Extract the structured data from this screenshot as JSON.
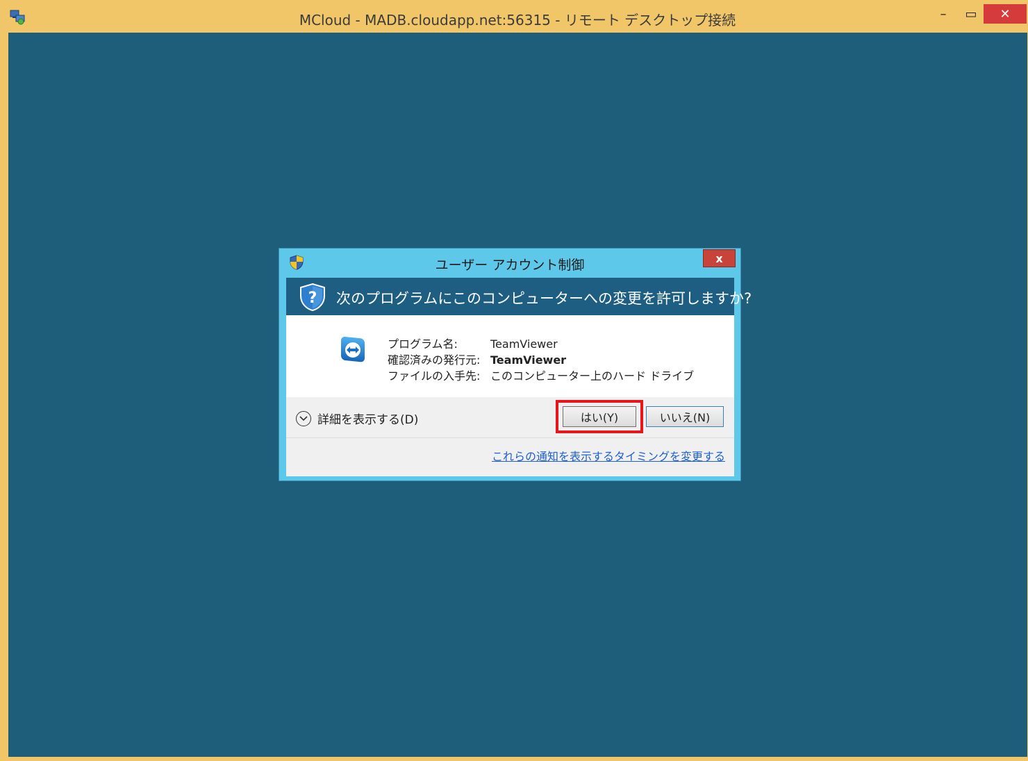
{
  "window": {
    "title": "MCloud - MADB.cloudapp.net:56315 - リモート デスクトップ接続",
    "minimize_label": "–",
    "maximize_label": "▭",
    "close_label": "✕"
  },
  "uac": {
    "title": "ユーザー アカウント制御",
    "close_label": "x",
    "question": "次のプログラムにこのコンピューターへの変更を許可しますか?",
    "program_name_label": "プログラム名:",
    "program_name_value": "TeamViewer",
    "publisher_label": "確認済みの発行元:",
    "publisher_value": "TeamViewer",
    "origin_label": "ファイルの入手先:",
    "origin_value": "このコンピューター上のハード ドライブ",
    "details_label": "詳細を表示する(D)",
    "yes_label": "はい(Y)",
    "no_label": "いいえ(N)",
    "timing_link": "これらの通知を表示するタイミングを変更する"
  },
  "colors": {
    "window_frame": "#f1c668",
    "desktop": "#1f5e7a",
    "dialog_frame": "#5ec8ea",
    "dialog_header": "#1d5e82",
    "highlight": "#e8151b",
    "link": "#1f5fd6"
  }
}
